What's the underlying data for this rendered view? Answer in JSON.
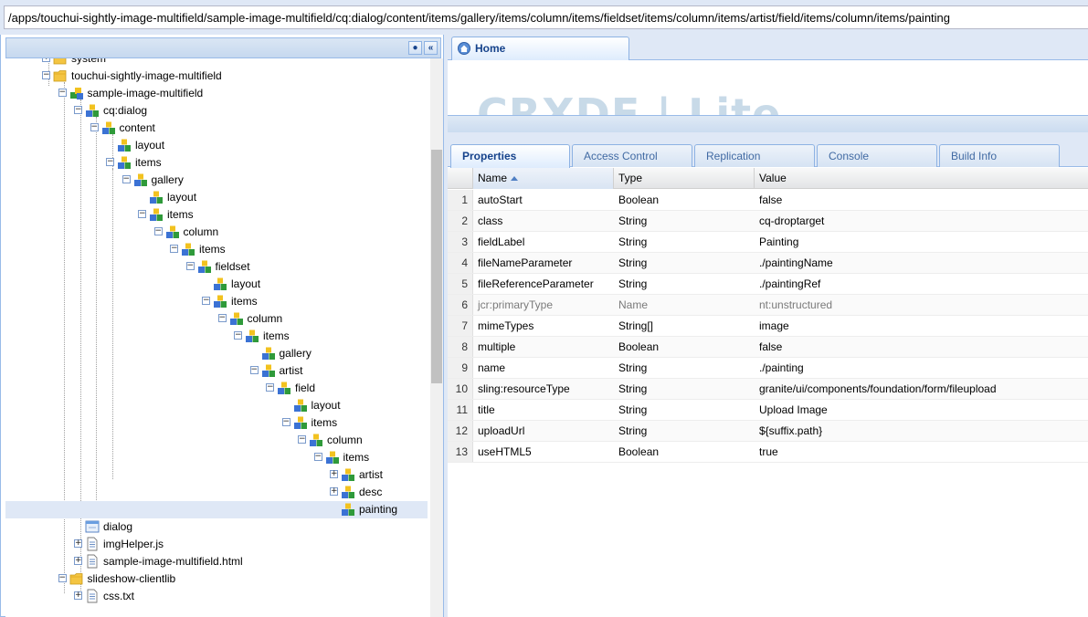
{
  "address_bar": {
    "path": "/apps/touchui-sightly-image-multifield/sample-image-multifield/cq:dialog/content/items/gallery/items/column/items/fieldset/items/column/items/artist/field/items/column/items/painting"
  },
  "tree": {
    "nodes": [
      {
        "label": "system",
        "icon": "folder-icon",
        "expander": "+"
      },
      {
        "label": "touchui-sightly-image-multifield",
        "icon": "folder-icon",
        "expander": "-"
      },
      {
        "label": "sample-image-multifield",
        "icon": "component-node-icon",
        "expander": "-"
      },
      {
        "label": "cq:dialog",
        "icon": "node-icon",
        "expander": "-"
      },
      {
        "label": "content",
        "icon": "node-icon",
        "expander": "-"
      },
      {
        "label": "layout",
        "icon": "node-icon",
        "expander": ""
      },
      {
        "label": "items",
        "icon": "node-icon",
        "expander": "-"
      },
      {
        "label": "gallery",
        "icon": "node-icon",
        "expander": "-"
      },
      {
        "label": "layout",
        "icon": "node-icon",
        "expander": ""
      },
      {
        "label": "items",
        "icon": "node-icon",
        "expander": "-"
      },
      {
        "label": "column",
        "icon": "node-icon",
        "expander": "-"
      },
      {
        "label": "items",
        "icon": "node-icon",
        "expander": "-"
      },
      {
        "label": "fieldset",
        "icon": "node-icon",
        "expander": "-"
      },
      {
        "label": "layout",
        "icon": "node-icon",
        "expander": ""
      },
      {
        "label": "items",
        "icon": "node-icon",
        "expander": "-"
      },
      {
        "label": "column",
        "icon": "node-icon",
        "expander": "-"
      },
      {
        "label": "items",
        "icon": "node-icon",
        "expander": "-"
      },
      {
        "label": "gallery",
        "icon": "node-icon",
        "expander": ""
      },
      {
        "label": "artist",
        "icon": "node-icon",
        "expander": "-"
      },
      {
        "label": "field",
        "icon": "node-icon",
        "expander": "-"
      },
      {
        "label": "layout",
        "icon": "node-icon",
        "expander": ""
      },
      {
        "label": "items",
        "icon": "node-icon",
        "expander": "-"
      },
      {
        "label": "column",
        "icon": "node-icon",
        "expander": "-"
      },
      {
        "label": "items",
        "icon": "node-icon",
        "expander": "-"
      },
      {
        "label": "artist",
        "icon": "node-icon",
        "expander": "+"
      },
      {
        "label": "desc",
        "icon": "node-icon",
        "expander": "+"
      },
      {
        "label": "painting",
        "icon": "node-icon",
        "expander": "",
        "selected": true
      },
      {
        "label": "dialog",
        "icon": "dialog-file-icon",
        "expander": ""
      },
      {
        "label": "imgHelper.js",
        "icon": "file-icon",
        "expander": "+"
      },
      {
        "label": "sample-image-multifield.html",
        "icon": "file-icon",
        "expander": "+"
      },
      {
        "label": "slideshow-clientlib",
        "icon": "folder-icon",
        "expander": "-"
      },
      {
        "label": "css.txt",
        "icon": "file-icon",
        "expander": "+"
      }
    ]
  },
  "home_tab": {
    "label": "Home"
  },
  "logo": {
    "text": "CRXDE | Lite"
  },
  "tabs": [
    {
      "label": "Properties",
      "active": true
    },
    {
      "label": "Access Control"
    },
    {
      "label": "Replication"
    },
    {
      "label": "Console"
    },
    {
      "label": "Build Info"
    }
  ],
  "grid": {
    "columns": [
      "Name",
      "Type",
      "Value"
    ],
    "sorted_column": "Name",
    "rows": [
      {
        "n": "1",
        "name": "autoStart",
        "type": "Boolean",
        "value": "false"
      },
      {
        "n": "2",
        "name": "class",
        "type": "String",
        "value": "cq-droptarget"
      },
      {
        "n": "3",
        "name": "fieldLabel",
        "type": "String",
        "value": "Painting"
      },
      {
        "n": "4",
        "name": "fileNameParameter",
        "type": "String",
        "value": "./paintingName"
      },
      {
        "n": "5",
        "name": "fileReferenceParameter",
        "type": "String",
        "value": "./paintingRef"
      },
      {
        "n": "6",
        "name": "jcr:primaryType",
        "type": "Name",
        "value": "nt:unstructured",
        "dim": true
      },
      {
        "n": "7",
        "name": "mimeTypes",
        "type": "String[]",
        "value": "image"
      },
      {
        "n": "8",
        "name": "multiple",
        "type": "Boolean",
        "value": "false"
      },
      {
        "n": "9",
        "name": "name",
        "type": "String",
        "value": "./painting"
      },
      {
        "n": "10",
        "name": "sling:resourceType",
        "type": "String",
        "value": "granite/ui/components/foundation/form/fileupload"
      },
      {
        "n": "11",
        "name": "title",
        "type": "String",
        "value": "Upload Image"
      },
      {
        "n": "12",
        "name": "uploadUrl",
        "type": "String",
        "value": "${suffix.path}"
      },
      {
        "n": "13",
        "name": "useHTML5",
        "type": "Boolean",
        "value": "true"
      }
    ]
  },
  "colors": {
    "panel_border": "#99bbe8",
    "tab_text": "#15428b",
    "folder": "#f0c040",
    "node_blue": "#3d7ad4",
    "node_green": "#3aa53a",
    "node_yellow": "#e8c020",
    "selected_row": "#dfe8f6"
  }
}
